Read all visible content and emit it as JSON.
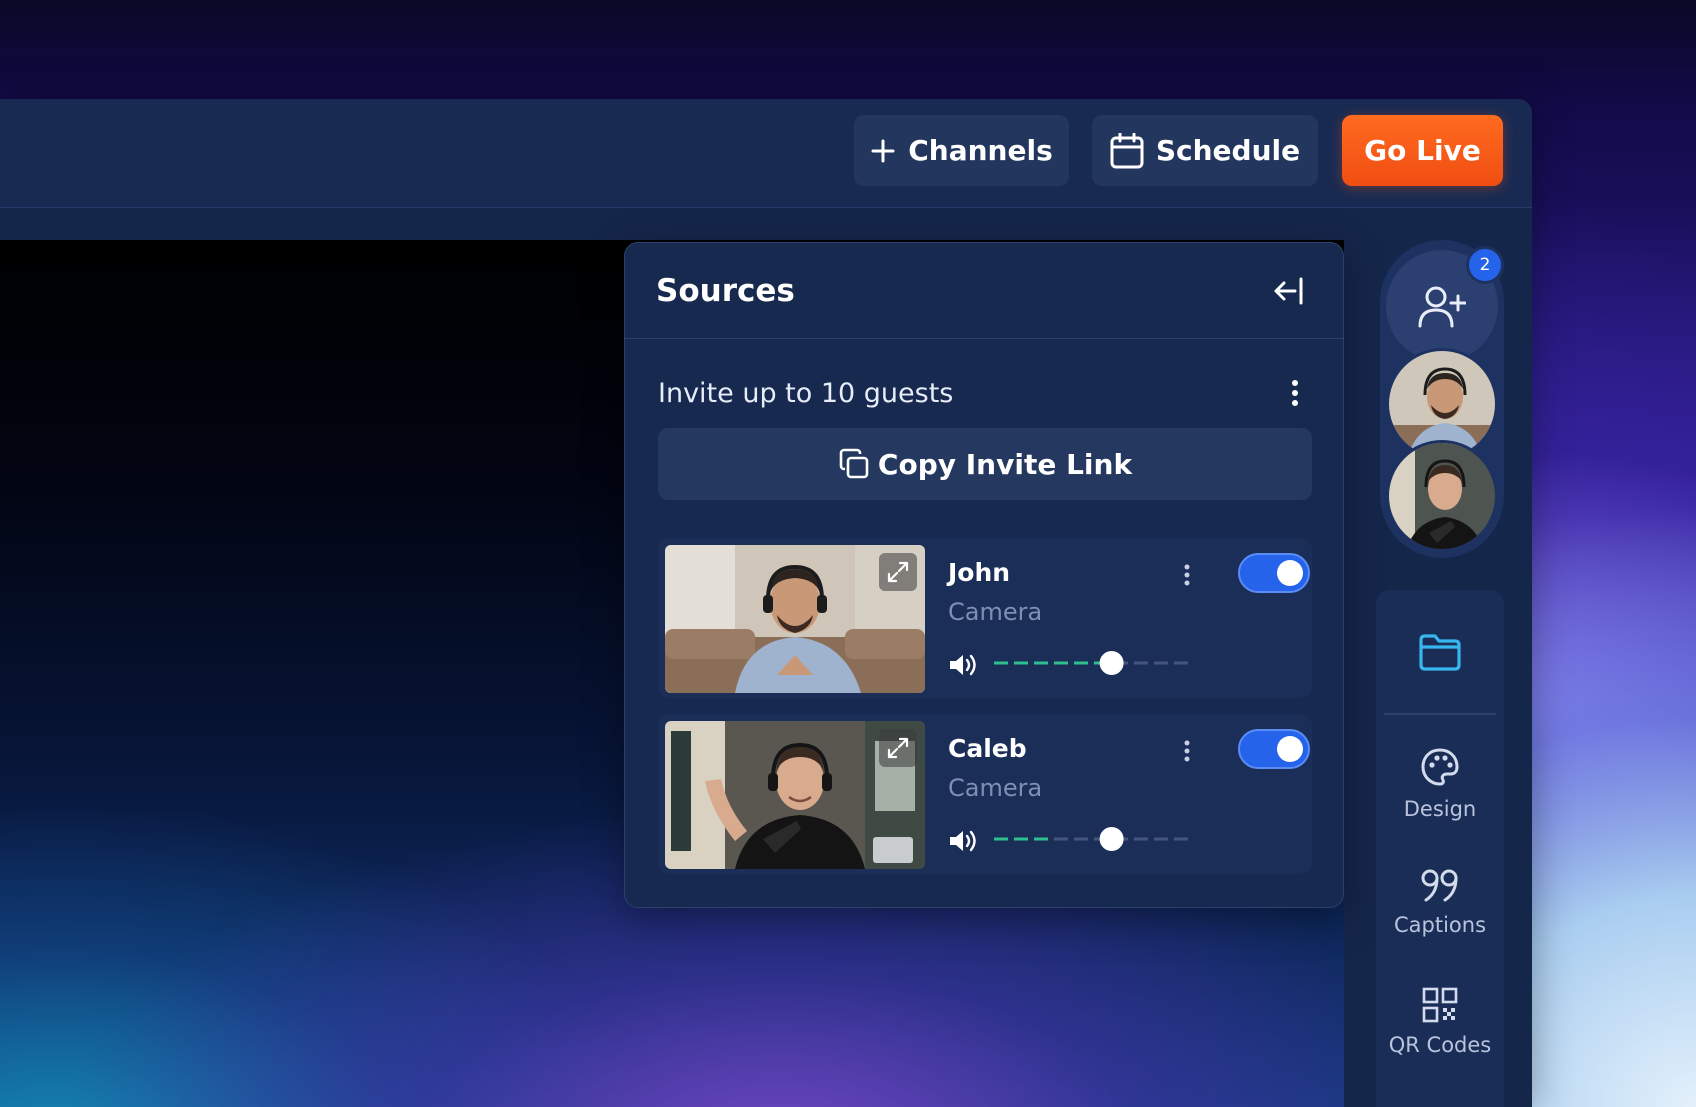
{
  "colors": {
    "accent": "#2563eb",
    "go_live": "#f25614",
    "panel_bg": "#17294f",
    "slider_active": "#2fbf8f"
  },
  "topbar": {
    "channels": {
      "label": "Channels",
      "icon": "plus-icon"
    },
    "schedule": {
      "label": "Schedule",
      "icon": "calendar-icon"
    },
    "go_live": {
      "label": "Go Live"
    }
  },
  "sources_panel": {
    "title": "Sources",
    "collapse_icon": "collapse-left-icon",
    "invite_text": "Invite up to 10 guests",
    "copy_invite_label": "Copy Invite Link",
    "guests": [
      {
        "name": "John",
        "type": "Camera",
        "enabled": true,
        "volume": 0.6
      },
      {
        "name": "Caleb",
        "type": "Camera",
        "enabled": true,
        "volume": 0.6
      }
    ]
  },
  "guest_rail": {
    "badge_count": "2",
    "add_guest_icon": "add-user-icon"
  },
  "tools": [
    {
      "label": "",
      "icon": "folder-icon"
    },
    {
      "label": "Design",
      "icon": "palette-icon"
    },
    {
      "label": "Captions",
      "icon": "quote-icon"
    },
    {
      "label": "QR Codes",
      "icon": "qr-code-icon"
    }
  ]
}
